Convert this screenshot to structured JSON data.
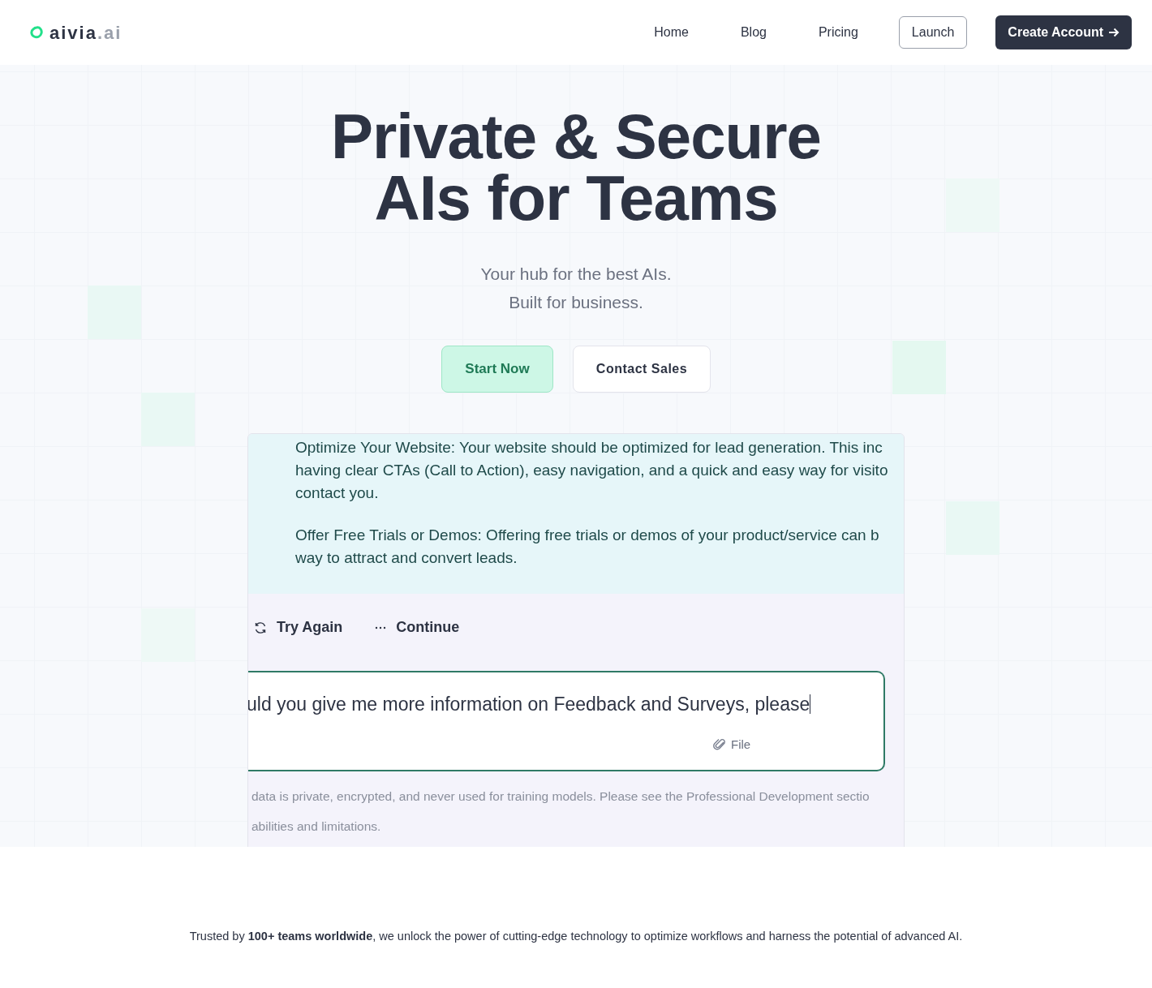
{
  "header": {
    "logo": {
      "name": "aivia",
      "suffix": ".ai"
    },
    "nav": [
      {
        "label": "Home",
        "kind": "link"
      },
      {
        "label": "Blog",
        "kind": "link"
      },
      {
        "label": "Pricing",
        "kind": "link"
      },
      {
        "label": "Launch",
        "kind": "outline"
      },
      {
        "label": "Create Account",
        "kind": "primary"
      }
    ]
  },
  "hero": {
    "title_lines": [
      "Private & Secure",
      "AIs for Teams"
    ],
    "subtitle_lines": [
      "Your hub for the best AIs.",
      "Built for business."
    ],
    "buttons": [
      {
        "label": "Start Now",
        "kind": "primary"
      },
      {
        "label": "Contact Sales",
        "kind": "secondary"
      }
    ]
  },
  "chat_demo": {
    "response_paragraphs": [
      [
        "Optimize Your Website: Your website should be optimized for lead generation. This inc",
        "having clear CTAs (Call to Action), easy navigation, and a quick and easy way for visito",
        "contact you."
      ],
      [
        "Offer Free Trials or Demos: Offering free trials or demos of your product/service can b",
        "way to attract and convert leads."
      ]
    ],
    "actions": [
      {
        "label": "Try Again",
        "kind": "retry"
      },
      {
        "label": "Continue",
        "kind": "more"
      }
    ],
    "input": {
      "value": "uld you give me more information on Feedback and Surveys, please",
      "file_button": "File"
    },
    "disclaimer_lines": [
      "data is private, encrypted, and never used for training models. Please see the Professional Development sectio",
      "abilities and limitations."
    ]
  },
  "footer_note": "Trusted by **100+ teams worldwide**, we unlock the power of cutting-edge technology to optimize workflows and harness the potential of advanced AI."
}
